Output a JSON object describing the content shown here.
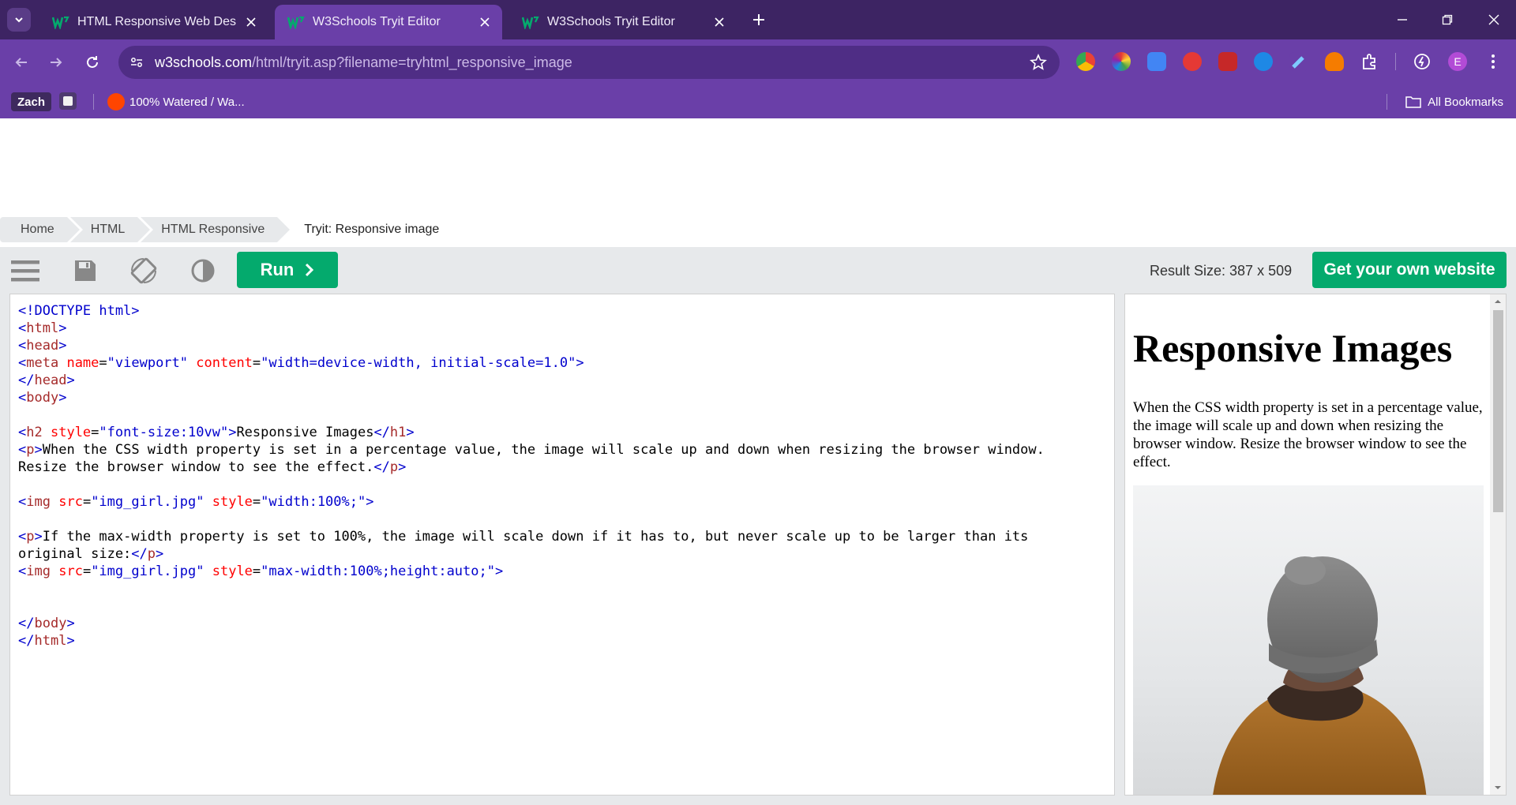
{
  "browser": {
    "tabs": [
      {
        "title": "HTML Responsive Web Design",
        "active": false
      },
      {
        "title": "W3Schools Tryit Editor",
        "active": true
      },
      {
        "title": "W3Schools Tryit Editor",
        "active": false
      }
    ],
    "url_host": "w3schools.com",
    "url_path": "/html/tryit.asp?filename=tryhtml_responsive_image",
    "profile_initial": "E",
    "bookmarks": {
      "profile_chip": "Zach",
      "item": "100% Watered / Wa...",
      "all_bookmarks": "All Bookmarks"
    }
  },
  "breadcrumb": [
    "Home",
    "HTML",
    "HTML Responsive",
    "Tryit: Responsive image"
  ],
  "tryit": {
    "run_label": "Run",
    "result_size": "Result Size: 387 x 509",
    "own_website_label": "Get your own website"
  },
  "code_lines": [
    "<!DOCTYPE html>",
    "<html>",
    "<head>",
    "<meta name=\"viewport\" content=\"width=device-width, initial-scale=1.0\">",
    "</head>",
    "<body>",
    "",
    "<h2 style=\"font-size:10vw\">Responsive Images</h1>",
    "<p>When the CSS width property is set in a percentage value, the image will scale up and down when resizing the browser window.",
    "Resize the browser window to see the effect.</p>",
    "",
    "<img src=\"img_girl.jpg\" style=\"width:100%;\">",
    "",
    "<p>If the max-width property is set to 100%, the image will scale down if it has to, but never scale up to be larger than its",
    "original size:</p>",
    "<img src=\"img_girl.jpg\" style=\"max-width:100%;height:auto;\">",
    "",
    "",
    "</body>",
    "</html>"
  ],
  "result": {
    "heading": "Responsive Images",
    "paragraph": "When the CSS width property is set in a percentage value, the image will scale up and down when resizing the browser window. Resize the browser window to see the effect."
  },
  "colors": {
    "tabstrip": "#3d2463",
    "toolbar": "#6a3fa8",
    "w3_green": "#04aa6d",
    "panel_gray": "#e7e9eb"
  }
}
